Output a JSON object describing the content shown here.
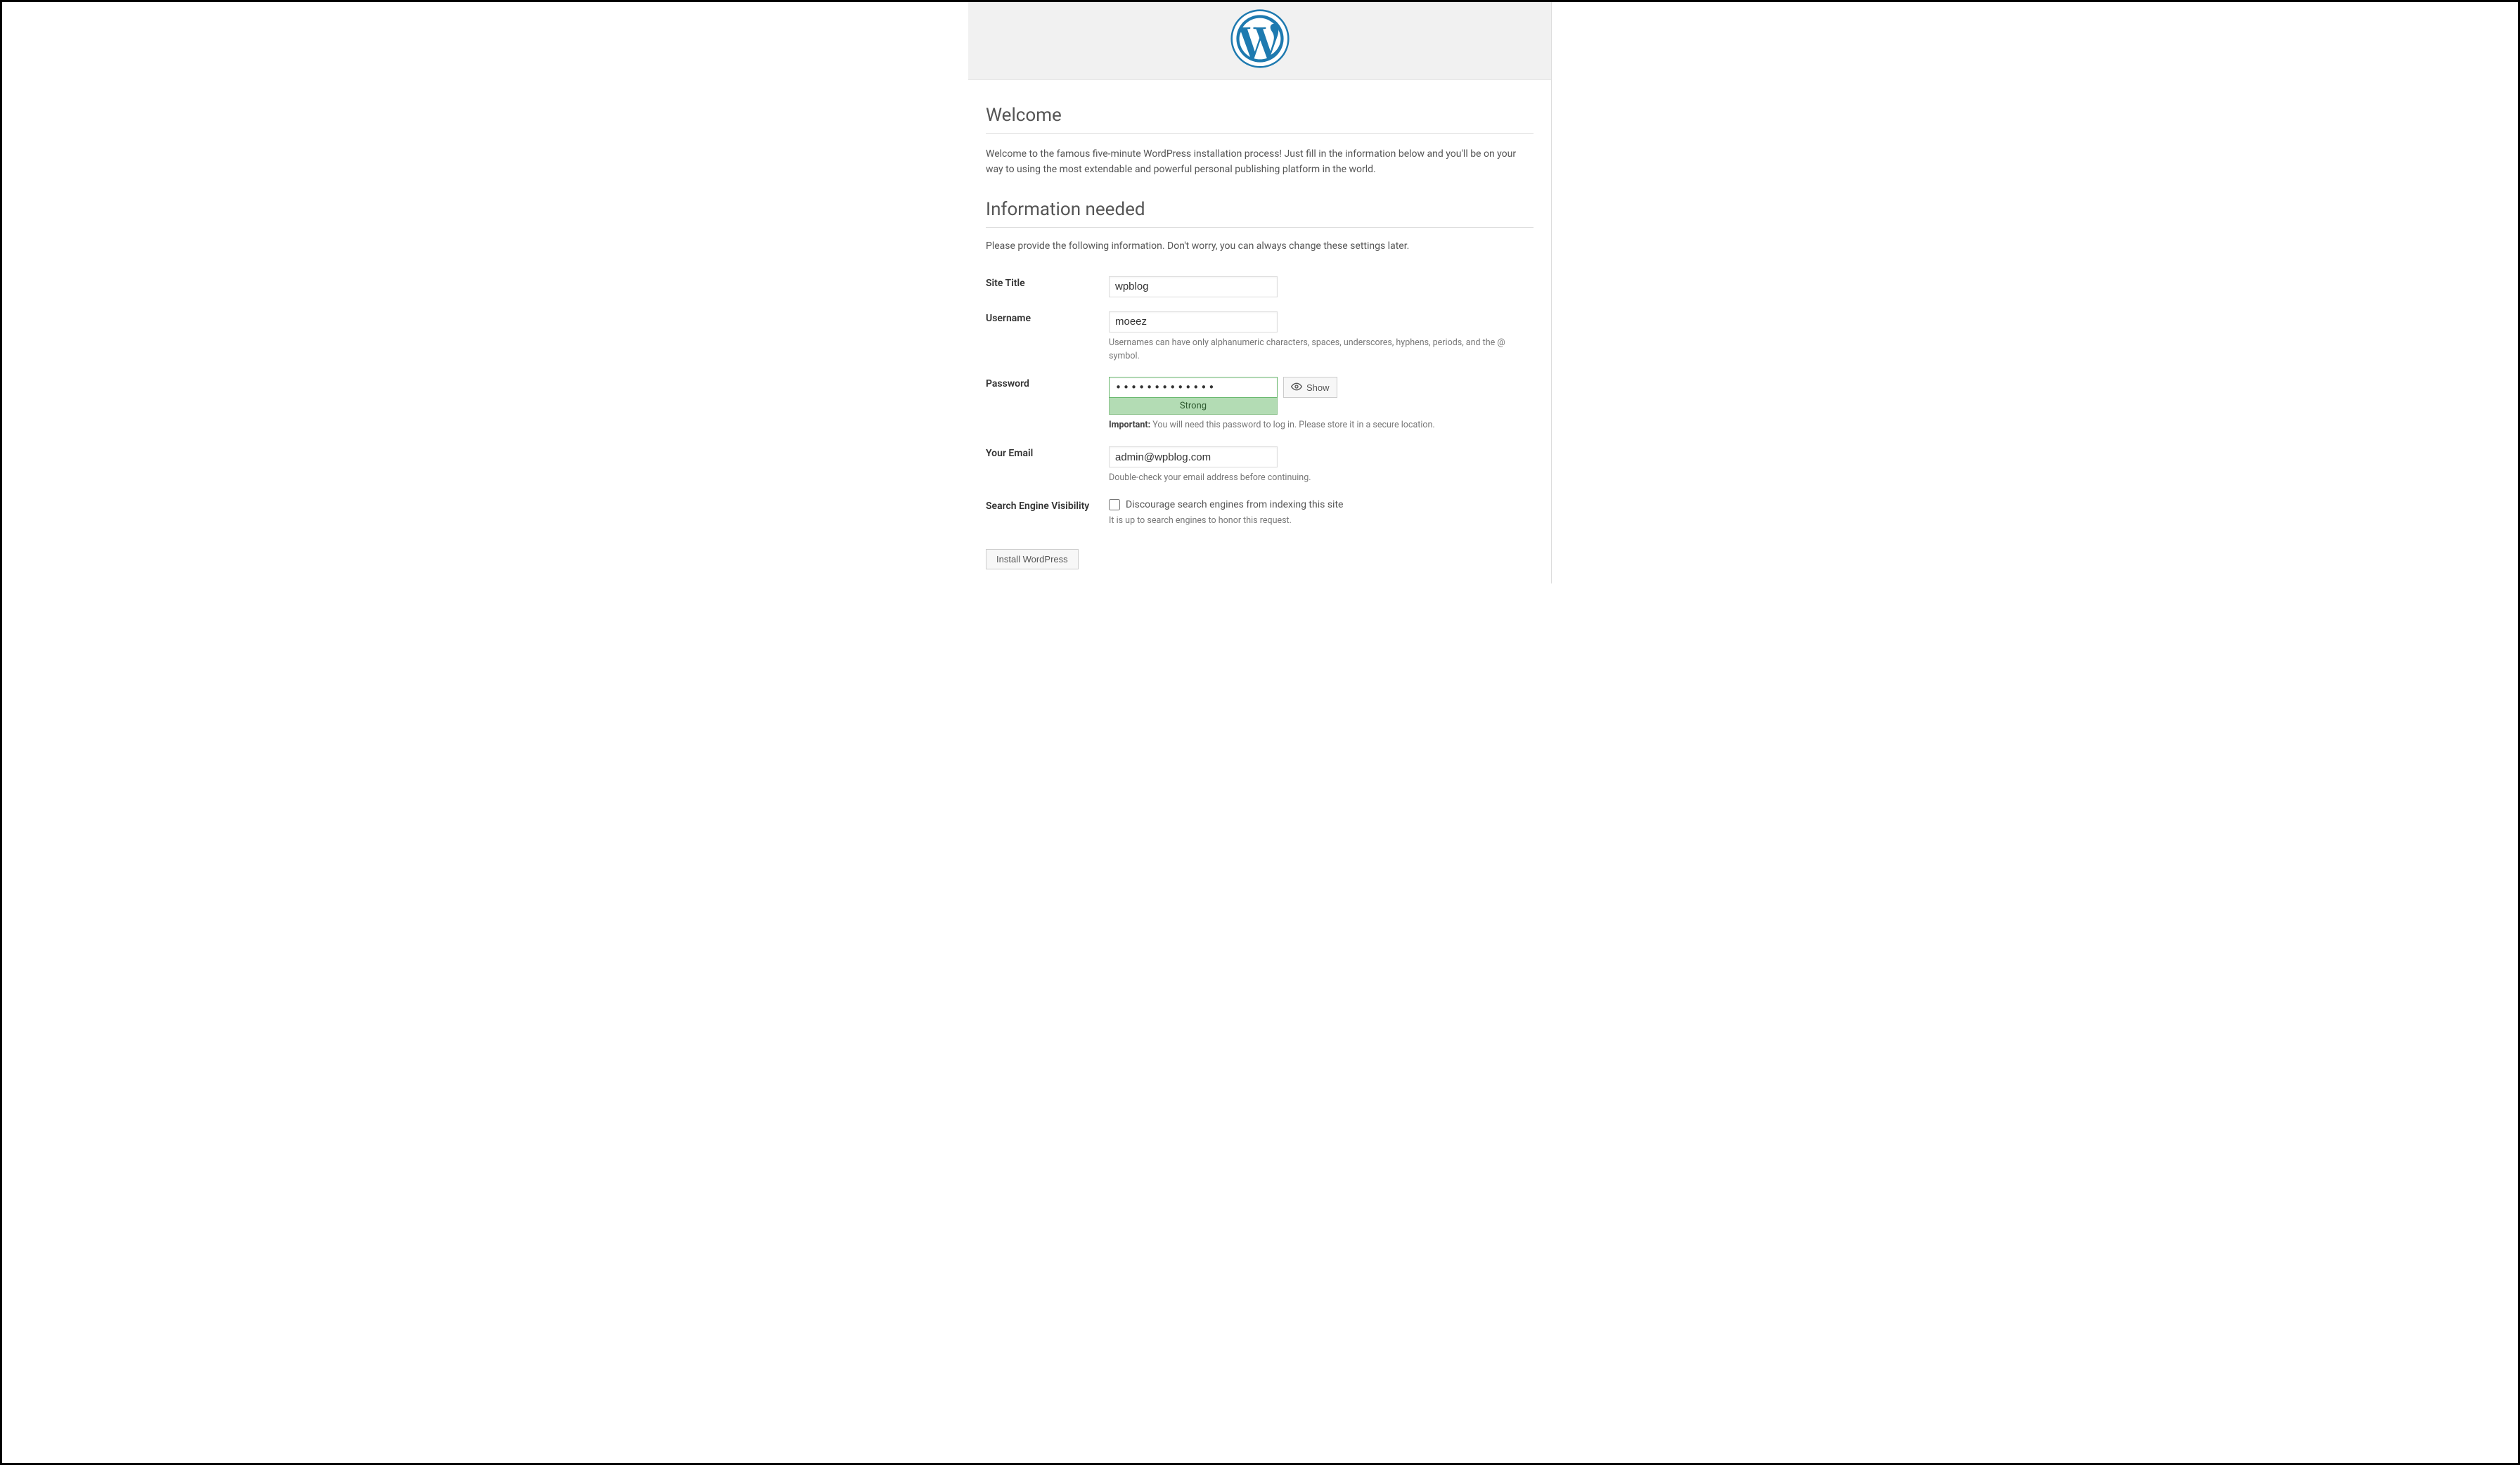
{
  "header": {
    "logo_name": "wordpress-logo"
  },
  "welcome": {
    "heading": "Welcome",
    "intro": "Welcome to the famous five-minute WordPress installation process! Just fill in the information below and you'll be on your way to using the most extendable and powerful personal publishing platform in the world."
  },
  "info": {
    "heading": "Information needed",
    "sub": "Please provide the following information. Don't worry, you can always change these settings later."
  },
  "form": {
    "site_title": {
      "label": "Site Title",
      "value": "wpblog"
    },
    "username": {
      "label": "Username",
      "value": "moeez",
      "desc": "Usernames can have only alphanumeric characters, spaces, underscores, hyphens, periods, and the @ symbol."
    },
    "password": {
      "label": "Password",
      "value": "•••••••••••••",
      "show_label": "Show",
      "strength": "Strong",
      "important_label": "Important:",
      "important_text": " You will need this password to log in. Please store it in a secure location."
    },
    "email": {
      "label": "Your Email",
      "value": "admin@wpblog.com",
      "desc": "Double-check your email address before continuing."
    },
    "search_visibility": {
      "label": "Search Engine Visibility",
      "checkbox_label": "Discourage search engines from indexing this site",
      "desc": "It is up to search engines to honor this request."
    }
  },
  "submit": {
    "label": "Install WordPress"
  }
}
